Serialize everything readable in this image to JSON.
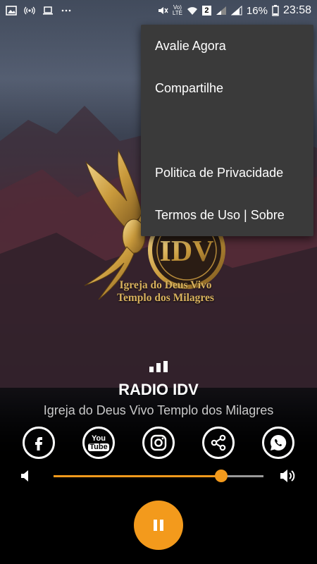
{
  "status_bar": {
    "battery": "16%",
    "time": "23:58",
    "sim_badge": "2",
    "network": "LTE",
    "volte": "Vo)",
    "icons": [
      "image-icon",
      "hotspot-icon",
      "laptop-icon",
      "more-dots-icon",
      "mute-icon",
      "volte-lte-icon",
      "wifi-icon",
      "sim-2-icon",
      "signal-icon",
      "battery-icon"
    ]
  },
  "menu": {
    "items": [
      {
        "label": "Avalie Agora"
      },
      {
        "label": "Compartilhe"
      },
      {
        "label": ""
      },
      {
        "label": "Politica de Privacidade"
      },
      {
        "label": "Termos de Uso | Sobre"
      }
    ]
  },
  "logo": {
    "monogram": "IDV",
    "line1": "Igreja do Deus Vivo",
    "line2": "Templo dos Milagres"
  },
  "station": {
    "title": "RADIO IDV",
    "subtitle": "Igreja do Deus Vivo Templo dos Milagres"
  },
  "social": {
    "youtube_label_top": "You",
    "youtube_label_bottom": "Tube",
    "icons": [
      "facebook-icon",
      "youtube-icon",
      "instagram-icon",
      "share-icon",
      "whatsapp-icon"
    ]
  },
  "player": {
    "volume_level": 0.8,
    "state": "playing"
  },
  "colors": {
    "accent": "#f39a1c",
    "menu_bg": "#3a3a3a",
    "logo_gold": "#d9b25e"
  }
}
